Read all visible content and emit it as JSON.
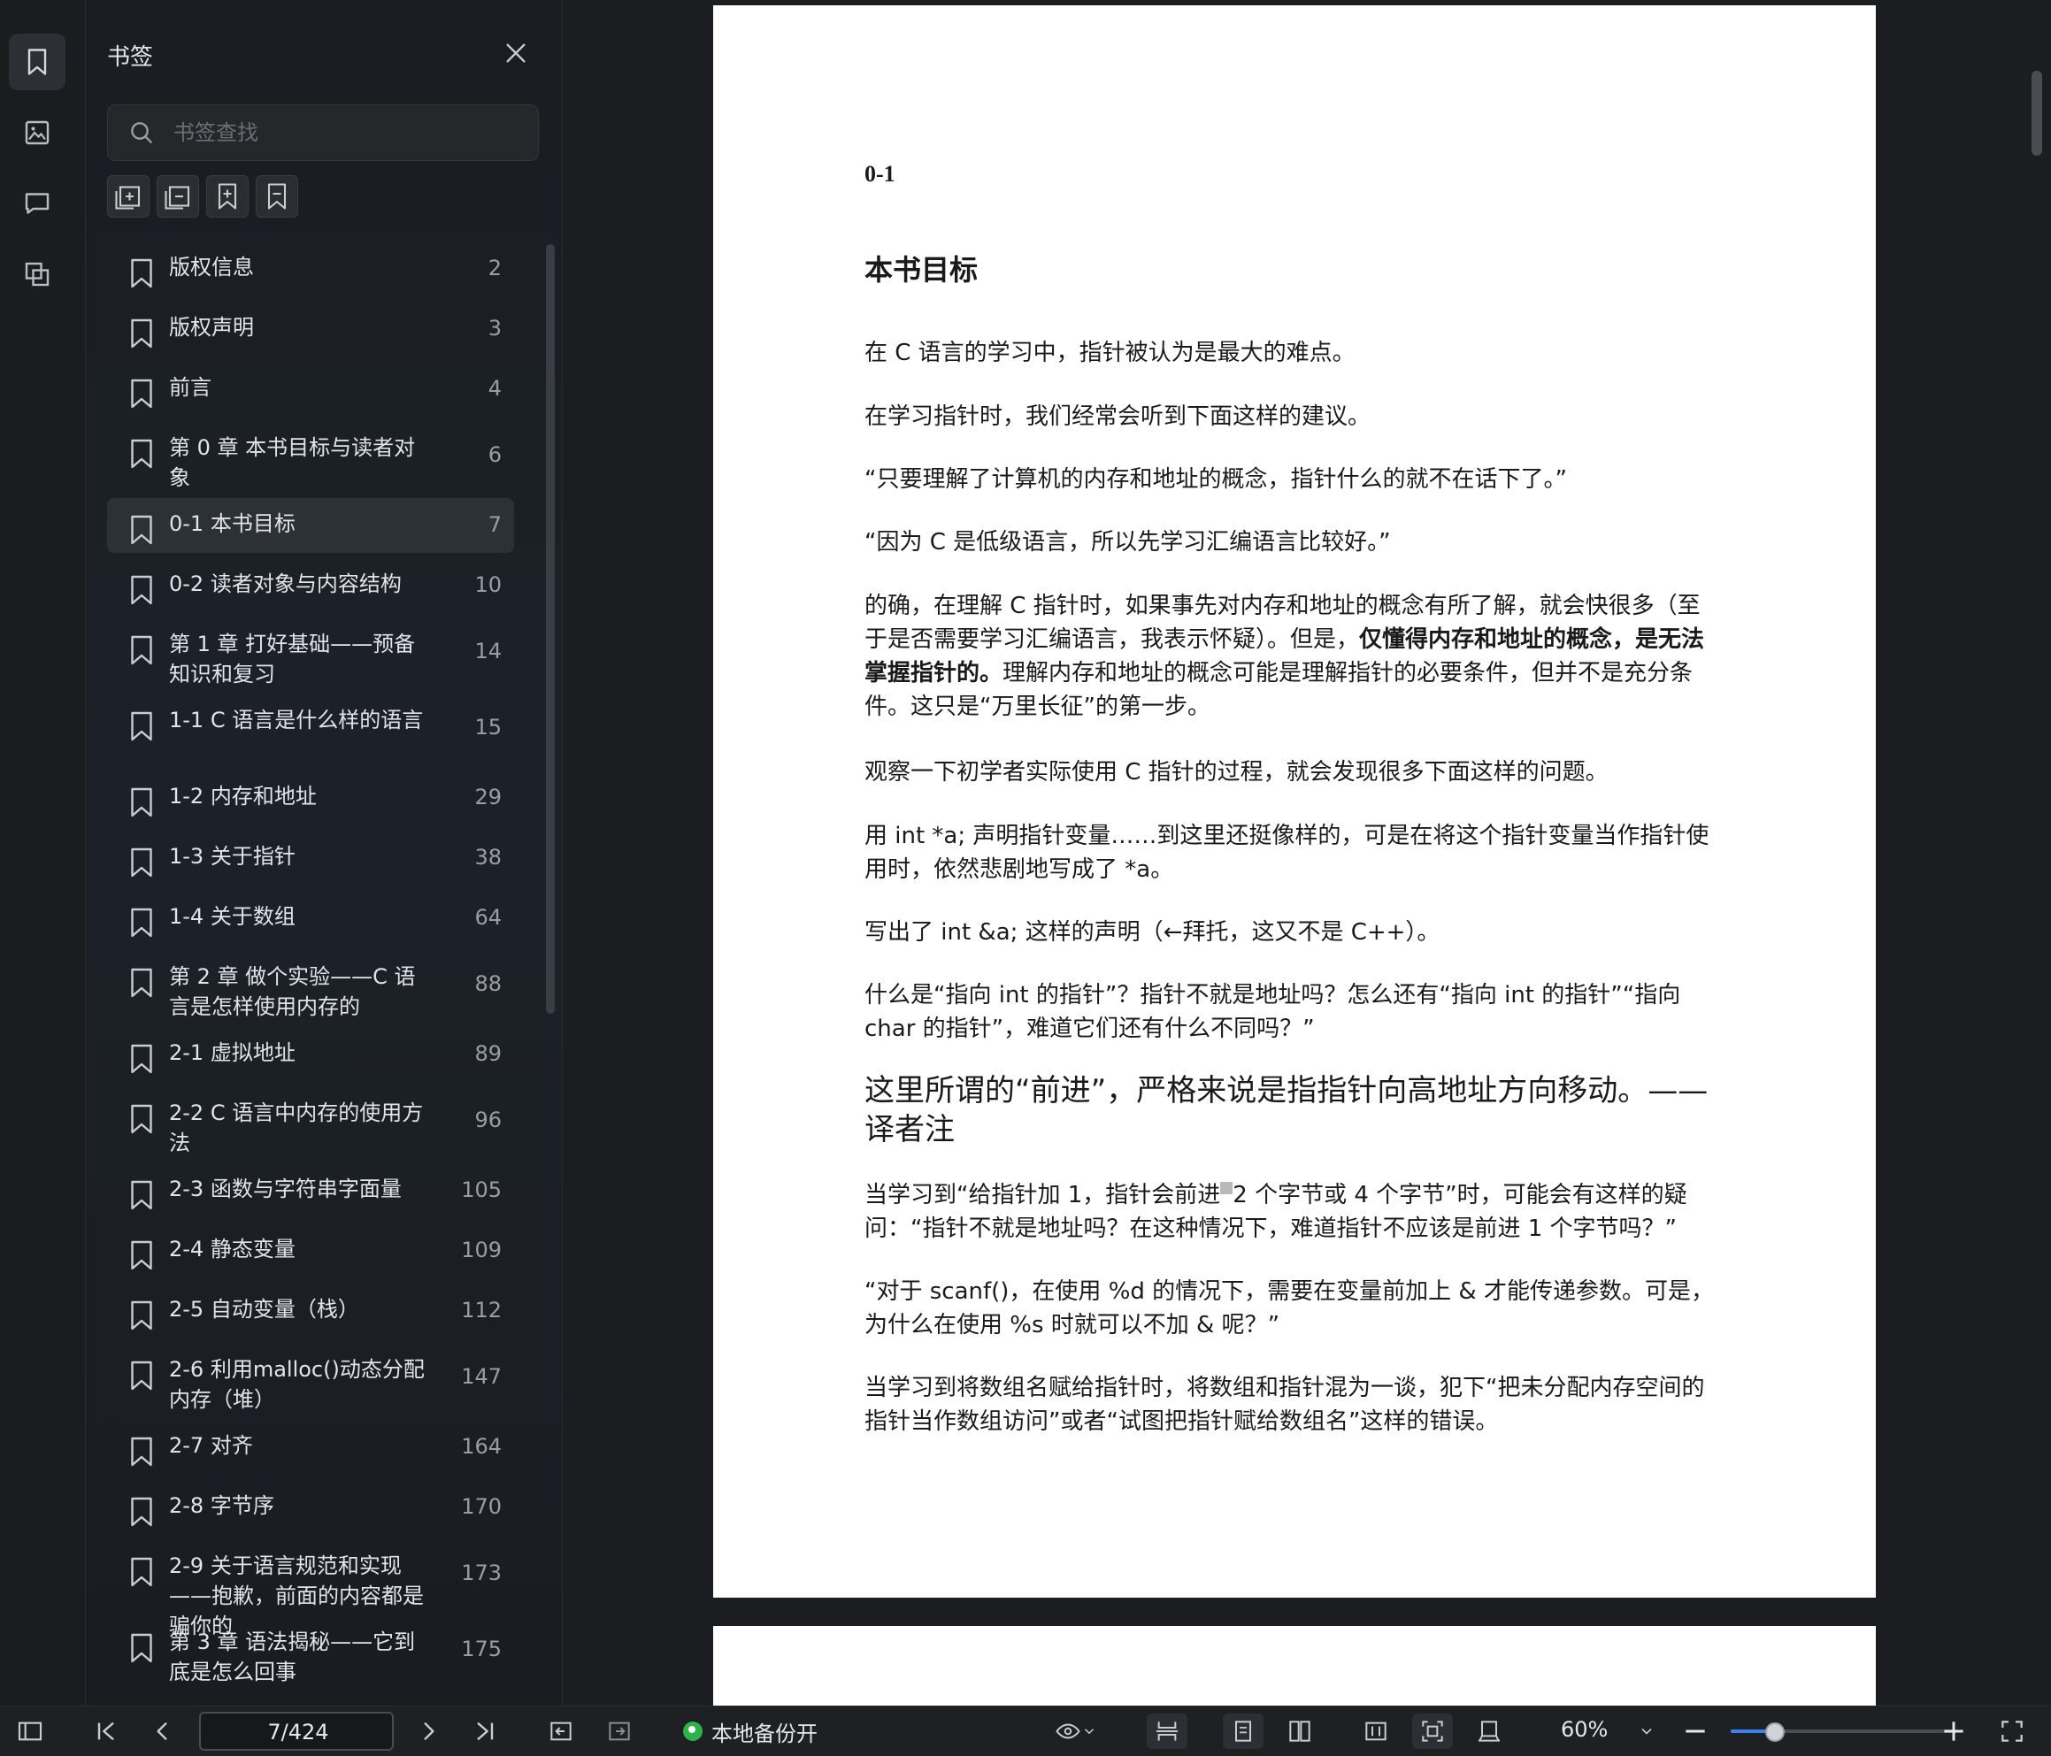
{
  "rail": {
    "items": [
      {
        "icon": "bookmark-icon",
        "active": true
      },
      {
        "icon": "image-icon",
        "active": false
      },
      {
        "icon": "comment-icon",
        "active": false
      },
      {
        "icon": "layers-icon",
        "active": false
      }
    ]
  },
  "panel": {
    "title": "书签",
    "search_placeholder": "书签查找",
    "tools": [
      "expand-all-icon",
      "collapse-all-icon",
      "add-bookmark-icon",
      "remove-bookmark-icon"
    ],
    "bookmarks": [
      {
        "label": "版权信息",
        "page": "2"
      },
      {
        "label": "版权声明",
        "page": "3"
      },
      {
        "label": "前言",
        "page": "4"
      },
      {
        "label": "第 0 章 本书目标与读者对象",
        "page": "6"
      },
      {
        "label": "0-1 本书目标",
        "page": "7",
        "active": true
      },
      {
        "label": "0-2 读者对象与内容结构",
        "page": "10"
      },
      {
        "label": "第 1 章 打好基础——预备知识和复习",
        "page": "14"
      },
      {
        "label": "1-1 C 语言是什么样的语言",
        "page": "15"
      },
      {
        "label": "1-2 内存和地址",
        "page": "29"
      },
      {
        "label": "1-3 关于指针",
        "page": "38"
      },
      {
        "label": "1-4 关于数组",
        "page": "64"
      },
      {
        "label": "第 2 章 做个实验——C 语言是怎样使用内存的",
        "page": "88"
      },
      {
        "label": "2-1 虚拟地址",
        "page": "89"
      },
      {
        "label": "2-2 C 语言中内存的使用方法",
        "page": "96"
      },
      {
        "label": "2-3 函数与字符串字面量",
        "page": "105"
      },
      {
        "label": "2-4 静态变量",
        "page": "109"
      },
      {
        "label": "2-5 自动变量（栈）",
        "page": "112"
      },
      {
        "label": "2-6 利用malloc()动态分配内存（堆）",
        "page": "147"
      },
      {
        "label": "2-7 对齐",
        "page": "164"
      },
      {
        "label": "2-8 字节序",
        "page": "170"
      },
      {
        "label": "2-9 关于语言规范和实现——抱歉，前面的内容都是骗你的",
        "page": "173"
      },
      {
        "label": "第 3 章 语法揭秘——它到底是怎么回事",
        "page": "175"
      }
    ]
  },
  "document": {
    "section_number": "0-1",
    "heading": "本书目标",
    "p1": "在 C 语言的学习中，指针被认为是最大的难点。",
    "p2": "在学习指针时，我们经常会听到下面这样的建议。",
    "p3": "“只要理解了计算机的内存和地址的概念，指针什么的就不在话下了。”",
    "p4": "“因为 C 是低级语言，所以先学习汇编语言比较好。”",
    "p5_a": "的确，在理解 C 指针时，如果事先对内存和地址的概念有所了解，就会快很多（至于是否需要学习汇编语言，我表示怀疑）。但是，",
    "p5_bold": "仅懂得内存和地址的概念，是无法掌握指针的。",
    "p5_b": "理解内存和地址的概念可能是理解指针的必要条件，但并不是充分条件。这只是“万里长征”的第一步。",
    "p6": "观察一下初学者实际使用 C 指针的过程，就会发现很多下面这样的问题。",
    "p7": "用 int *a; 声明指针变量……到这里还挺像样的，可是在将这个指针变量当作指针使用时，依然悲剧地写成了 *a。",
    "p8": "写出了 int &a; 这样的声明（←拜托，这又不是 C++）。",
    "p9": "什么是“指向 int 的指针”？指针不就是地址吗？怎么还有“指向 int 的指针”“指向 char 的指针”，难道它们还有什么不同吗？”",
    "p10_big": "这里所谓的“前进”，严格来说是指指针向高地址方向移动。——译者注",
    "p11_a": "当学习到“给指针加 1，指针会前进",
    "p11_b": "2 个字节或 4 个字节”时，可能会有这样的疑问：“指针不就是地址吗？在这种情况下，难道指针不应该是前进 1 个字节吗？”",
    "p12": "“对于 scanf()，在使用 %d 的情况下，需要在变量前加上 & 才能传递参数。可是，为什么在使用 %s 时就可以不加 & 呢？”",
    "p13": "当学习到将数组名赋给指针时，将数组和指针混为一谈，犯下“把未分配内存空间的指针当作数组访问”或者“试图把指针赋给数组名”这样的错误。"
  },
  "toolbar": {
    "page_value": "7/424",
    "backup_label": "本地备份开",
    "zoom_label": "60%",
    "zoom_fraction": 0.19,
    "backup_color": "#2fb24a",
    "accent": "#3b82f6"
  }
}
